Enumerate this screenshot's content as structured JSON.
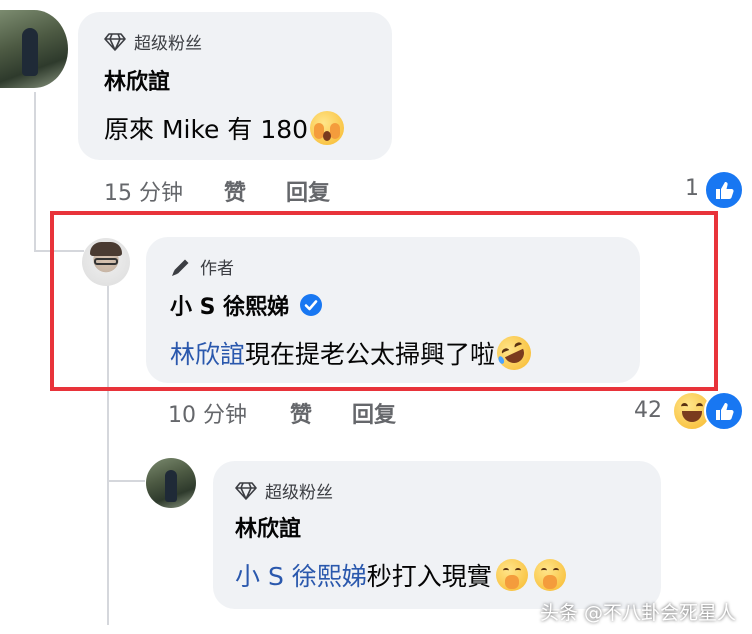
{
  "comments": [
    {
      "badge": "超级粉丝",
      "author": "林欣誼",
      "text": "原來 Mike 有 180",
      "time": "15 分钟",
      "like_label": "赞",
      "reply_label": "回复",
      "reaction_count": "1"
    },
    {
      "badge": "作者",
      "author": "小 S 徐熙娣",
      "mention": "林欣誼",
      "text": "現在提老公太掃興了啦",
      "time": "10 分钟",
      "like_label": "赞",
      "reply_label": "回复",
      "reaction_count": "42"
    },
    {
      "badge": "超级粉丝",
      "author": "林欣誼",
      "mention": "小 S 徐熙娣",
      "text": " 秒打入現實"
    }
  ],
  "watermark": "头条 @不八卦会死星人",
  "colors": {
    "highlight": "#e8333a",
    "like_blue": "#1877f2",
    "mention": "#2a58ad",
    "bubble": "#f0f2f5"
  }
}
